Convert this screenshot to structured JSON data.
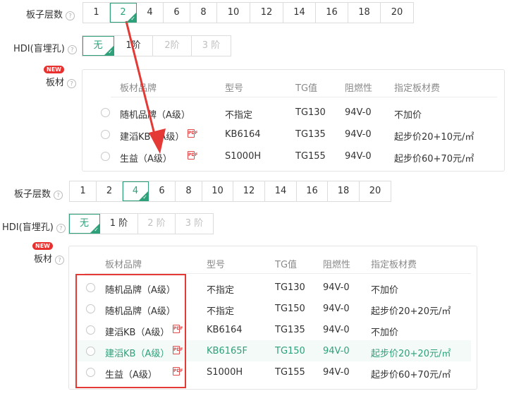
{
  "top": {
    "layers_label": "板子层数",
    "layers": [
      "1",
      "2",
      "4",
      "6",
      "8",
      "10",
      "12",
      "14",
      "16",
      "18",
      "20"
    ],
    "layers_selected": "2",
    "hdi_label": "HDI(盲埋孔)",
    "hdi_options": [
      "无",
      "1阶",
      "2阶",
      "3 阶"
    ],
    "hdi_selected": "无",
    "new_badge": "NEW",
    "material_label": "板材",
    "headers": [
      "板材品牌",
      "型号",
      "TG值",
      "阻燃性",
      "指定板材费"
    ],
    "rows": [
      {
        "brand": "随机品牌（A级）",
        "model": "不指定",
        "tg": "TG130",
        "flame": "94V-0",
        "fee": "不加价",
        "pdf": false
      },
      {
        "brand": "建滔KB（A级）",
        "model": "KB6164",
        "tg": "TG135",
        "flame": "94V-0",
        "fee": "起步价20+10元/㎡",
        "pdf": true
      },
      {
        "brand": "生益（A级）",
        "model": "S1000H",
        "tg": "TG155",
        "flame": "94V-0",
        "fee": "起步价60+70元/㎡",
        "pdf": true
      }
    ]
  },
  "bottom": {
    "layers_label": "板子层数",
    "layers": [
      "1",
      "2",
      "4",
      "6",
      "8",
      "10",
      "12",
      "14",
      "16",
      "18",
      "20"
    ],
    "layers_selected": "4",
    "hdi_label": "HDI(盲埋孔)",
    "hdi_options": [
      "无",
      "1 阶",
      "2 阶",
      "3 阶"
    ],
    "hdi_selected": "无",
    "new_badge": "NEW",
    "material_label": "板材",
    "headers": [
      "板材品牌",
      "型号",
      "TG值",
      "阻燃性",
      "指定板材费"
    ],
    "rows": [
      {
        "brand": "随机品牌（A级）",
        "model": "不指定",
        "tg": "TG130",
        "flame": "94V-0",
        "fee": "不加价",
        "pdf": false,
        "highlight": false
      },
      {
        "brand": "随机品牌（A级）",
        "model": "不指定",
        "tg": "TG150",
        "flame": "94V-0",
        "fee": "起步价20+20元/㎡",
        "pdf": false,
        "highlight": false
      },
      {
        "brand": "建滔KB（A级）",
        "model": "KB6164",
        "tg": "TG135",
        "flame": "94V-0",
        "fee": "不加价",
        "pdf": true,
        "highlight": false
      },
      {
        "brand": "建滔KB（A级）",
        "model": "KB6165F",
        "tg": "TG150",
        "flame": "94V-0",
        "fee": "起步价20+20元/㎡",
        "pdf": true,
        "highlight": true
      },
      {
        "brand": "生益（A级）",
        "model": "S1000H",
        "tg": "TG155",
        "flame": "94V-0",
        "fee": "起步价60+70元/㎡",
        "pdf": true,
        "highlight": false
      }
    ]
  },
  "icons": {
    "help": "question-circle-icon",
    "pdf": "pdf-file-icon",
    "check": "check-icon",
    "arrow": "red-arrow-annotation"
  },
  "colors": {
    "accent": "#2ea17a",
    "red": "#e53935",
    "new": "#e8312f"
  }
}
